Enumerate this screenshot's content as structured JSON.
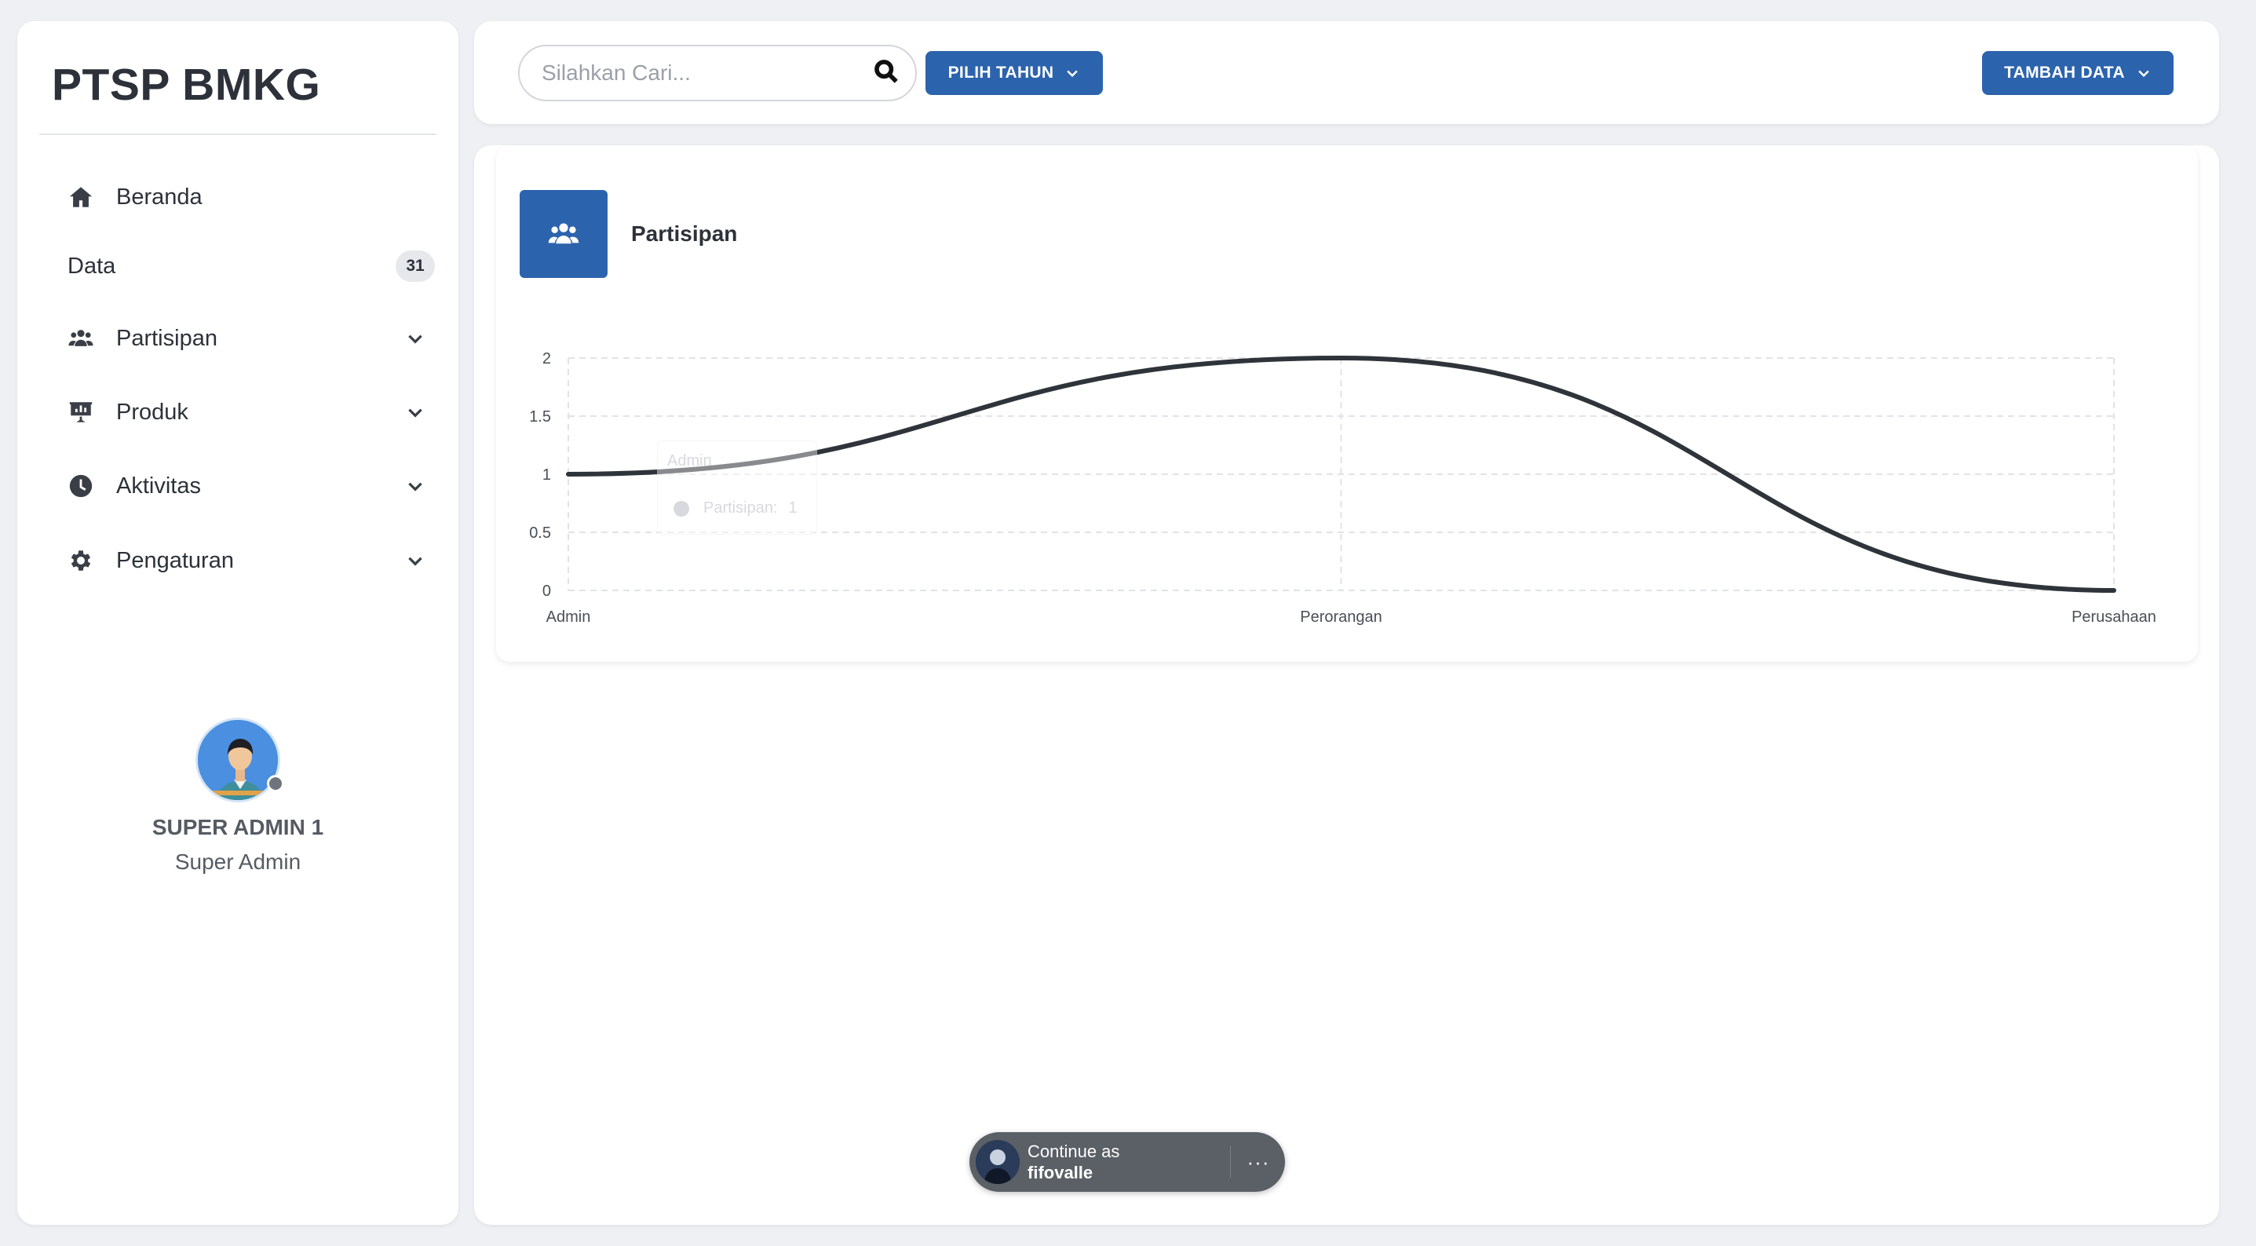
{
  "sidebar": {
    "brand": "PTSP BMKG",
    "items": [
      {
        "label": "Beranda",
        "icon": "home-icon"
      },
      {
        "label": "Data",
        "badge": "31"
      },
      {
        "label": "Partisipan",
        "icon": "users-icon"
      },
      {
        "label": "Produk",
        "icon": "presentation-icon"
      },
      {
        "label": "Aktivitas",
        "icon": "clock-icon"
      },
      {
        "label": "Pengaturan",
        "icon": "gear-icon"
      }
    ],
    "profile": {
      "name": "SUPER ADMIN 1",
      "role": "Super Admin"
    }
  },
  "topbar": {
    "search": {
      "value": "",
      "placeholder": "Silahkan Cari..."
    },
    "year_button": "PILIH TAHUN",
    "add_button": "TAMBAH DATA"
  },
  "card": {
    "title": "Partisipan",
    "icon": "users-icon"
  },
  "chart_data": {
    "type": "line",
    "categories": [
      "Admin",
      "Perorangan",
      "Perusahaan"
    ],
    "series": [
      {
        "name": "Partisipan",
        "values": [
          1,
          2,
          0
        ]
      }
    ],
    "ylim": [
      0,
      2
    ],
    "yticks": [
      "0",
      "0.5",
      "1",
      "1.5",
      "2"
    ],
    "grid": true,
    "line_color": "#2f333a",
    "tooltip": {
      "title": "Admin",
      "label": "Partisipan:",
      "value": "1"
    }
  },
  "fedcm": {
    "line1": "Continue as",
    "line2": "fifovalle",
    "more": "···"
  }
}
